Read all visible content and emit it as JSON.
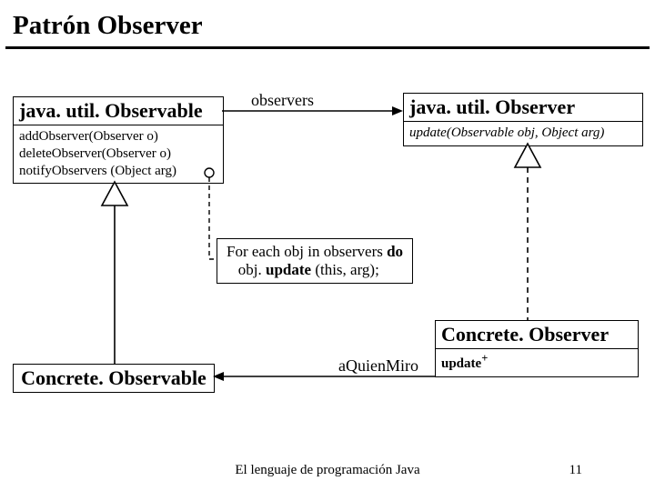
{
  "title": "Patrón Observer",
  "observable": {
    "name": "java. util. Observable",
    "ops": [
      "addObserver(Observer o)",
      "deleteObserver(Observer o)",
      "notifyObservers (Object arg)"
    ]
  },
  "observer": {
    "name": "java. util. Observer",
    "op_italic": "update(Observable obj, Object arg)"
  },
  "assoc": {
    "label_observers": "observers",
    "label_aquien": "aQuienMiro"
  },
  "note": {
    "line1_pre": "For each obj in observers ",
    "line1_bold": "do",
    "line2_pre": "   obj. ",
    "line2_bold": "update",
    "line2_post": " (this, arg);"
  },
  "concrete_observable": {
    "name": "Concrete. Observable"
  },
  "concrete_observer": {
    "name": "Concrete. Observer",
    "op_bold": "update",
    "op_sup": "+"
  },
  "footer": "El lenguaje de programación Java",
  "page": "11"
}
